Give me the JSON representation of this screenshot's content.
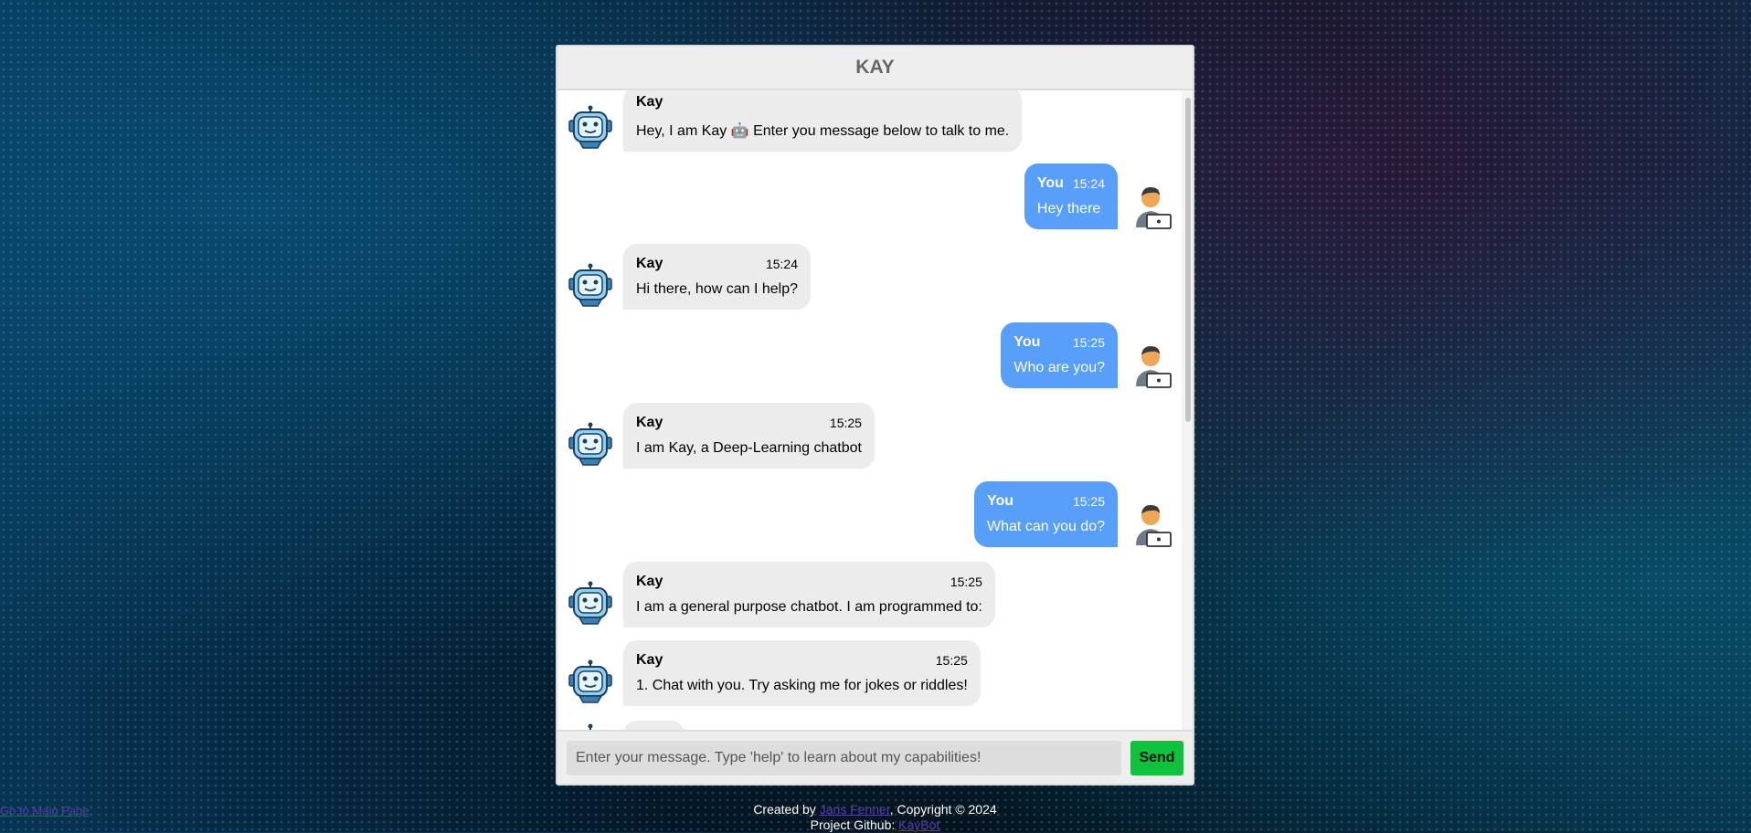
{
  "header": {
    "title": "KAY"
  },
  "messages": [
    {
      "side": "left",
      "name": "Kay",
      "time": "",
      "text": "Hey, I am Kay 🤖 Enter you message below to talk to me."
    },
    {
      "side": "right",
      "name": "You",
      "time": "15:24",
      "text": "Hey there"
    },
    {
      "side": "left",
      "name": "Kay",
      "time": "15:24",
      "text": "Hi there, how can I help?"
    },
    {
      "side": "right",
      "name": "You",
      "time": "15:25",
      "text": "Who are you?"
    },
    {
      "side": "left",
      "name": "Kay",
      "time": "15:25",
      "text": "I am Kay, a Deep-Learning chatbot"
    },
    {
      "side": "right",
      "name": "You",
      "time": "15:25",
      "text": "What can you do?"
    },
    {
      "side": "left",
      "name": "Kay",
      "time": "15:25",
      "text": "I am a general purpose chatbot. I am programmed to:"
    },
    {
      "side": "left",
      "name": "Kay",
      "time": "15:25",
      "text": "1. Chat with you. Try asking me for jokes or riddles!"
    },
    {
      "side": "left",
      "name": "Kay",
      "time": "",
      "text": ""
    }
  ],
  "input": {
    "placeholder": "Enter your message. Type 'help' to learn about my capabilities!",
    "send_label": "Send"
  },
  "links": {
    "main_page": "Go to Main Page"
  },
  "footer": {
    "created_by_prefix": "Created by ",
    "author": "Jaris Fenner",
    "copyright": ", Copyright © 2024",
    "github_prefix": "Project Github: ",
    "github_link": "KayBot"
  },
  "colors": {
    "bot_bubble": "#ececec",
    "user_bubble": "#579ffb",
    "send_button": "#0ec23c"
  },
  "icons": {
    "bot_avatar": "robot-avatar-icon",
    "user_avatar": "person-laptop-avatar-icon"
  }
}
